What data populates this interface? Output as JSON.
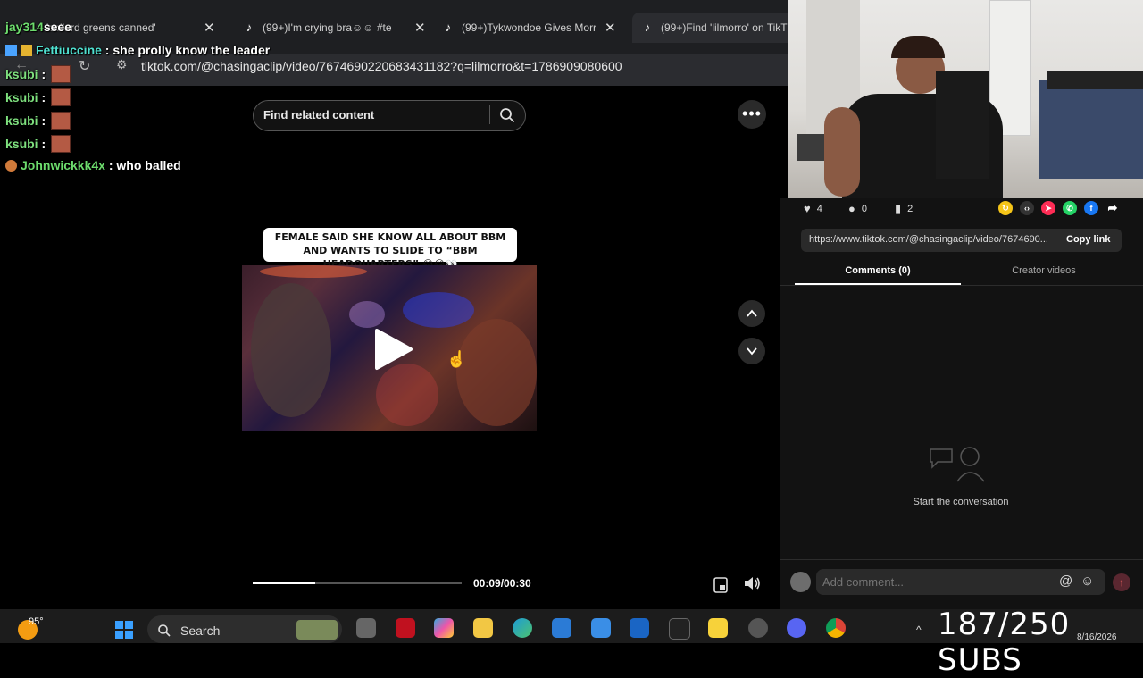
{
  "browser": {
    "tabs": [
      {
        "label": "'collard greens canned'",
        "icon": "tiktok-icon",
        "active": false
      },
      {
        "label": "(99+)I'm crying bra☺☺ #te",
        "icon": "tiktok-icon",
        "active": false
      },
      {
        "label": "(99+)Tykwondoe Gives Morr",
        "icon": "tiktok-icon",
        "active": false
      },
      {
        "label": "(99+)Find 'lilmorro' on TikT",
        "icon": "tiktok-icon",
        "active": true
      }
    ],
    "url": "tiktok.com/@chasingaclip/video/7674690220683431182?q=lilmorro&t=1786909080600"
  },
  "chat": [
    {
      "user": "jay314",
      "message": "seee",
      "emote": false
    },
    {
      "user": "Fettiuccine",
      "message": "she prolly know the leader",
      "emote": false
    },
    {
      "user": "ksubi",
      "message": "",
      "emote": true
    },
    {
      "user": "ksubi",
      "message": "",
      "emote": true
    },
    {
      "user": "ksubi",
      "message": "",
      "emote": true
    },
    {
      "user": "ksubi",
      "message": "",
      "emote": true
    },
    {
      "user": "Johnwickkk4x",
      "message": "who balled",
      "emote": false
    }
  ],
  "tiktok": {
    "search_placeholder": "Find related content",
    "caption": "FEMALE SAID SHE KNOW ALL ABOUT BBM AND WANTS TO SLIDE TO “BBM HEADQUARTERS” 😂😂👀",
    "time": "00:09/00:30",
    "progress": 0.3,
    "stats": {
      "likes": "4",
      "comments": "0",
      "saves": "2"
    },
    "share_link": "https://www.tiktok.com/@chasingaclip/video/7674690...",
    "copy_link_label": "Copy link",
    "tab_comments": "Comments (0)",
    "tab_creator": "Creator videos",
    "empty_state": "Start the conversation",
    "comment_placeholder": "Add comment...",
    "mention_symbol": "@"
  },
  "taskbar": {
    "weather": "95°",
    "search_label": "Search",
    "overlay_text": "187/250 SUBS",
    "date": "8/16/2026"
  },
  "colors": {
    "chat_username": "#7ee07e",
    "send_button": "#5a2730",
    "taskbar": "#1c1c1c"
  }
}
